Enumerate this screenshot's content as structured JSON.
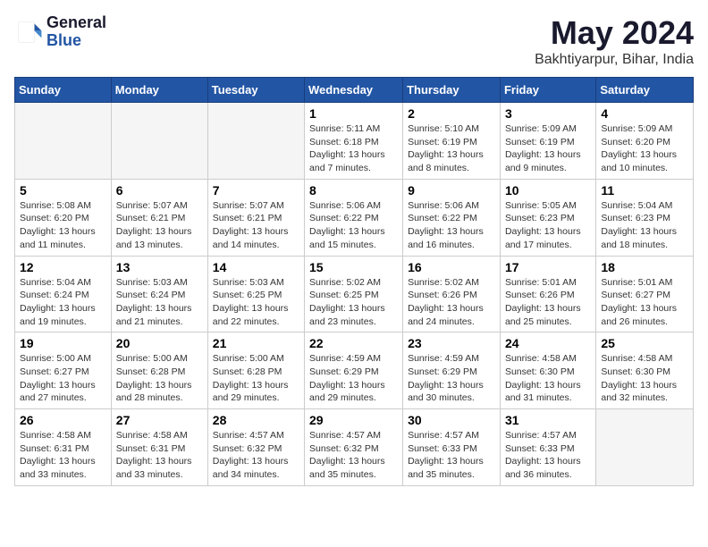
{
  "logo": {
    "line1": "General",
    "line2": "Blue"
  },
  "title": "May 2024",
  "location": "Bakhtiyarpur, Bihar, India",
  "days_header": [
    "Sunday",
    "Monday",
    "Tuesday",
    "Wednesday",
    "Thursday",
    "Friday",
    "Saturday"
  ],
  "weeks": [
    [
      {
        "num": "",
        "info": ""
      },
      {
        "num": "",
        "info": ""
      },
      {
        "num": "",
        "info": ""
      },
      {
        "num": "1",
        "info": "Sunrise: 5:11 AM\nSunset: 6:18 PM\nDaylight: 13 hours\nand 7 minutes."
      },
      {
        "num": "2",
        "info": "Sunrise: 5:10 AM\nSunset: 6:19 PM\nDaylight: 13 hours\nand 8 minutes."
      },
      {
        "num": "3",
        "info": "Sunrise: 5:09 AM\nSunset: 6:19 PM\nDaylight: 13 hours\nand 9 minutes."
      },
      {
        "num": "4",
        "info": "Sunrise: 5:09 AM\nSunset: 6:20 PM\nDaylight: 13 hours\nand 10 minutes."
      }
    ],
    [
      {
        "num": "5",
        "info": "Sunrise: 5:08 AM\nSunset: 6:20 PM\nDaylight: 13 hours\nand 11 minutes."
      },
      {
        "num": "6",
        "info": "Sunrise: 5:07 AM\nSunset: 6:21 PM\nDaylight: 13 hours\nand 13 minutes."
      },
      {
        "num": "7",
        "info": "Sunrise: 5:07 AM\nSunset: 6:21 PM\nDaylight: 13 hours\nand 14 minutes."
      },
      {
        "num": "8",
        "info": "Sunrise: 5:06 AM\nSunset: 6:22 PM\nDaylight: 13 hours\nand 15 minutes."
      },
      {
        "num": "9",
        "info": "Sunrise: 5:06 AM\nSunset: 6:22 PM\nDaylight: 13 hours\nand 16 minutes."
      },
      {
        "num": "10",
        "info": "Sunrise: 5:05 AM\nSunset: 6:23 PM\nDaylight: 13 hours\nand 17 minutes."
      },
      {
        "num": "11",
        "info": "Sunrise: 5:04 AM\nSunset: 6:23 PM\nDaylight: 13 hours\nand 18 minutes."
      }
    ],
    [
      {
        "num": "12",
        "info": "Sunrise: 5:04 AM\nSunset: 6:24 PM\nDaylight: 13 hours\nand 19 minutes."
      },
      {
        "num": "13",
        "info": "Sunrise: 5:03 AM\nSunset: 6:24 PM\nDaylight: 13 hours\nand 21 minutes."
      },
      {
        "num": "14",
        "info": "Sunrise: 5:03 AM\nSunset: 6:25 PM\nDaylight: 13 hours\nand 22 minutes."
      },
      {
        "num": "15",
        "info": "Sunrise: 5:02 AM\nSunset: 6:25 PM\nDaylight: 13 hours\nand 23 minutes."
      },
      {
        "num": "16",
        "info": "Sunrise: 5:02 AM\nSunset: 6:26 PM\nDaylight: 13 hours\nand 24 minutes."
      },
      {
        "num": "17",
        "info": "Sunrise: 5:01 AM\nSunset: 6:26 PM\nDaylight: 13 hours\nand 25 minutes."
      },
      {
        "num": "18",
        "info": "Sunrise: 5:01 AM\nSunset: 6:27 PM\nDaylight: 13 hours\nand 26 minutes."
      }
    ],
    [
      {
        "num": "19",
        "info": "Sunrise: 5:00 AM\nSunset: 6:27 PM\nDaylight: 13 hours\nand 27 minutes."
      },
      {
        "num": "20",
        "info": "Sunrise: 5:00 AM\nSunset: 6:28 PM\nDaylight: 13 hours\nand 28 minutes."
      },
      {
        "num": "21",
        "info": "Sunrise: 5:00 AM\nSunset: 6:28 PM\nDaylight: 13 hours\nand 29 minutes."
      },
      {
        "num": "22",
        "info": "Sunrise: 4:59 AM\nSunset: 6:29 PM\nDaylight: 13 hours\nand 29 minutes."
      },
      {
        "num": "23",
        "info": "Sunrise: 4:59 AM\nSunset: 6:29 PM\nDaylight: 13 hours\nand 30 minutes."
      },
      {
        "num": "24",
        "info": "Sunrise: 4:58 AM\nSunset: 6:30 PM\nDaylight: 13 hours\nand 31 minutes."
      },
      {
        "num": "25",
        "info": "Sunrise: 4:58 AM\nSunset: 6:30 PM\nDaylight: 13 hours\nand 32 minutes."
      }
    ],
    [
      {
        "num": "26",
        "info": "Sunrise: 4:58 AM\nSunset: 6:31 PM\nDaylight: 13 hours\nand 33 minutes."
      },
      {
        "num": "27",
        "info": "Sunrise: 4:58 AM\nSunset: 6:31 PM\nDaylight: 13 hours\nand 33 minutes."
      },
      {
        "num": "28",
        "info": "Sunrise: 4:57 AM\nSunset: 6:32 PM\nDaylight: 13 hours\nand 34 minutes."
      },
      {
        "num": "29",
        "info": "Sunrise: 4:57 AM\nSunset: 6:32 PM\nDaylight: 13 hours\nand 35 minutes."
      },
      {
        "num": "30",
        "info": "Sunrise: 4:57 AM\nSunset: 6:33 PM\nDaylight: 13 hours\nand 35 minutes."
      },
      {
        "num": "31",
        "info": "Sunrise: 4:57 AM\nSunset: 6:33 PM\nDaylight: 13 hours\nand 36 minutes."
      },
      {
        "num": "",
        "info": ""
      }
    ]
  ]
}
